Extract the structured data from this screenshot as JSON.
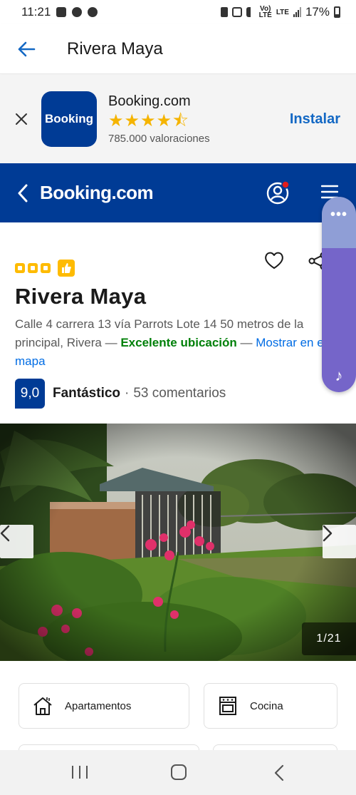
{
  "status_bar": {
    "time": "11:21",
    "battery": "17%",
    "network_small_1": "Vo)",
    "network_small_2": "LTE",
    "network_small_3": "LTE"
  },
  "app_header": {
    "title": "Rivera Maya",
    "back_icon": "arrow-left-icon"
  },
  "install_banner": {
    "app_icon_text": "Booking",
    "app_name": "Booking.com",
    "rating": 4.5,
    "stars": [
      "★",
      "★",
      "★",
      "★",
      "⯪"
    ],
    "reviews": "785.000 valoraciones",
    "install_label": "Instalar"
  },
  "site_header": {
    "logo": "Booking.com",
    "back_icon": "chevron-left-icon",
    "account_icon": "user-circle-icon",
    "menu_icon": "hamburger-menu-icon"
  },
  "floating_widget": {
    "dots": "•••",
    "music_icon": "♪"
  },
  "property": {
    "name": "Rivera Maya",
    "star_rating": 3,
    "address_line1": "Calle 4 carrera 13 vía Parrots Lote 14 50 metros de la",
    "address_line2_prefix": "principal, Rivera",
    "dash1": " — ",
    "location_badge": "Excelente ubicación",
    "dash2": " — ",
    "map_link_part1": "Mostrar en el",
    "map_link_part2": "mapa",
    "score": "9,0",
    "score_word": "Fantástico",
    "score_sep": "·",
    "review_count": "53 comentarios",
    "thumb_icon": "👍"
  },
  "gallery": {
    "counter": "1/21",
    "prev_icon": "chevron-left-icon",
    "next_icon": "chevron-right-icon"
  },
  "facilities": [
    {
      "label": "Apartamentos",
      "icon": "house-icon"
    },
    {
      "label": "Cocina",
      "icon": "stove-icon"
    },
    {
      "label": "",
      "icon": ""
    },
    {
      "label": "",
      "icon": ""
    }
  ],
  "colors": {
    "brand_blue": "#003b95",
    "link_blue": "#006ce4",
    "install_blue": "#1368c4",
    "star_yellow": "#febb02",
    "green": "#008009",
    "widget_purple": "#7565c9"
  }
}
